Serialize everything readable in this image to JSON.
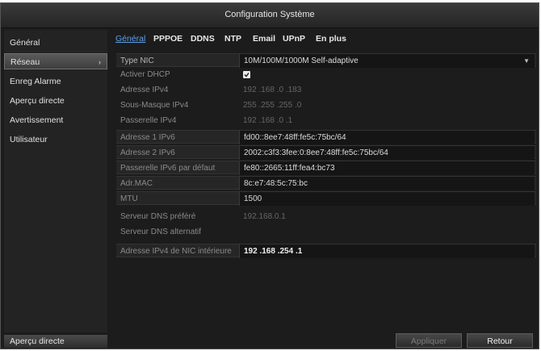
{
  "window": {
    "title": "Configuration Système"
  },
  "sidebar": {
    "items": [
      {
        "label": "Général"
      },
      {
        "label": "Réseau",
        "arrow": "›"
      },
      {
        "label": "Enreg Alarme"
      },
      {
        "label": "Aperçu directe"
      },
      {
        "label": "Avertissement"
      },
      {
        "label": "Utilisateur"
      }
    ],
    "bottom_label": "Aperçu directe"
  },
  "tabs": [
    {
      "label": "Général"
    },
    {
      "label": "PPPOE"
    },
    {
      "label": "DDNS"
    },
    {
      "label": "NTP"
    },
    {
      "label": "Email"
    },
    {
      "label": "UPnP"
    },
    {
      "label": "En plus"
    }
  ],
  "form": {
    "nic_type": {
      "label": "Type NIC",
      "value": "10M/100M/1000M Self-adaptive"
    },
    "dhcp": {
      "label": "Activer DHCP",
      "checked": true
    },
    "ipv4_address": {
      "label": "Adresse IPv4",
      "value": "192 .168 .0    .183"
    },
    "ipv4_mask": {
      "label": "Sous-Masque IPv4",
      "value": "255 .255 .255 .0"
    },
    "ipv4_gateway": {
      "label": "Passerelle IPv4",
      "value": "192 .168 .0    .1"
    },
    "ipv6_address1": {
      "label": "Adresse 1 IPv6",
      "value": "fd00::8ee7:48ff:fe5c:75bc/64"
    },
    "ipv6_address2": {
      "label": "Adresse 2 IPv6",
      "value": "2002:c3f3:3fee:0:8ee7:48ff:fe5c:75bc/64"
    },
    "ipv6_gateway": {
      "label": "Passerelle IPv6 par défaut",
      "value": "fe80::2665:11ff:fea4:bc73"
    },
    "mac": {
      "label": "Adr.MAC",
      "value": "8c:e7:48:5c:75:bc"
    },
    "mtu": {
      "label": "MTU",
      "value": "1500"
    },
    "dns_preferred": {
      "label": "Serveur DNS préféré",
      "value": "192.168.0.1"
    },
    "dns_alternate": {
      "label": "Serveur DNS alternatif",
      "value": ""
    },
    "internal_nic": {
      "label": "Adresse IPv4 de NIC intérieure",
      "value": "192 .168 .254 .1"
    }
  },
  "buttons": {
    "apply": "Appliquer",
    "back": "Retour"
  },
  "colors": {
    "active_tab": "#5fa0e8",
    "background": "#1c1c1c"
  }
}
